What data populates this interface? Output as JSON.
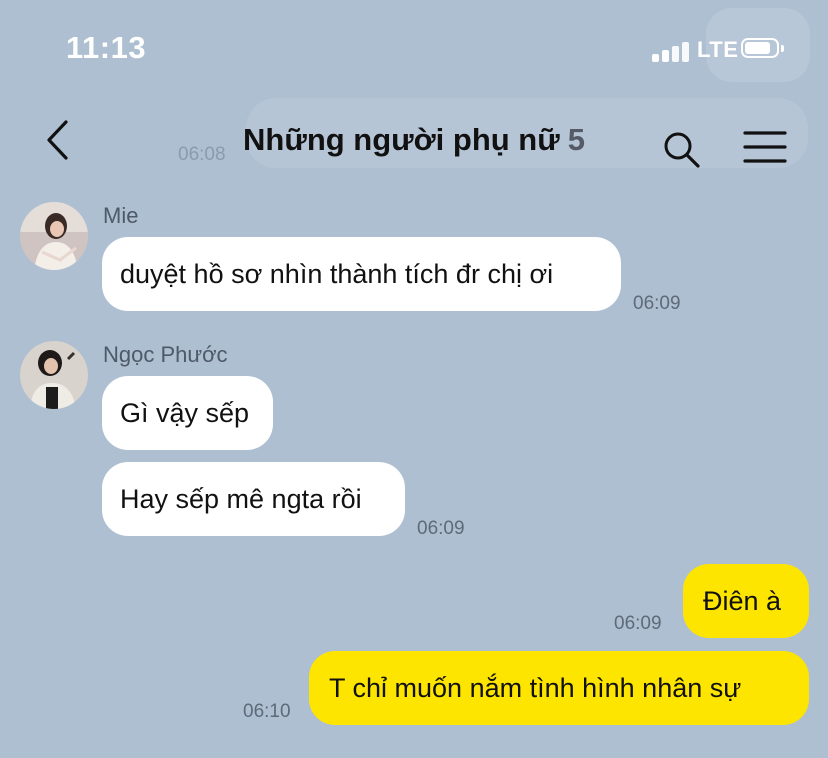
{
  "status": {
    "time": "11:13",
    "network": "LTE"
  },
  "header": {
    "title": "Những người phụ nữ",
    "member_count": "5",
    "faded_time": "06:08"
  },
  "messages": [
    {
      "sender": "Mie",
      "text": "duyệt hồ sơ nhìn thành tích đr chị ơi",
      "time": "06:09"
    },
    {
      "sender": "Ngọc Phước",
      "text": "Gì vậy sếp"
    },
    {
      "text": "Hay sếp mê ngta rồi",
      "time": "06:09"
    },
    {
      "text": "Điên à",
      "time": "06:09"
    },
    {
      "text": "T chỉ muốn nắm tình hình nhân sự",
      "time": "06:10"
    }
  ],
  "colors": {
    "background": "#aebfd2",
    "outgoing_bubble": "#fee500",
    "incoming_bubble": "#ffffff"
  },
  "icons": [
    "back-arrow-icon",
    "search-icon",
    "menu-icon",
    "signal-icon",
    "battery-icon"
  ]
}
